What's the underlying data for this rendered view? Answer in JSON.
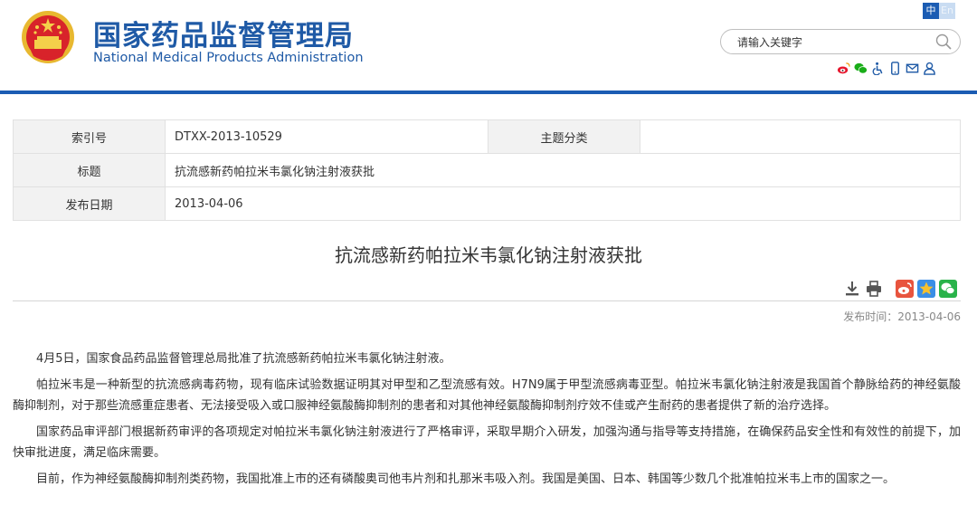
{
  "header": {
    "site_name_cn": "国家药品监督管理局",
    "site_name_en": "National Medical Products Administration",
    "lang_zh": "中",
    "lang_en": "En",
    "search_placeholder": "请输入关键字",
    "tool_icons": [
      "weibo-icon",
      "wechat-icon",
      "accessibility-icon",
      "mobile-icon",
      "mail-icon",
      "user-icon"
    ]
  },
  "info": {
    "index_label": "索引号",
    "index_value": "DTXX-2013-10529",
    "topic_label": "主题分类",
    "topic_value": "",
    "title_label": "标题",
    "title_value": "抗流感新药帕拉米韦氯化钠注射液获批",
    "date_label": "发布日期",
    "date_value": "2013-04-06"
  },
  "article": {
    "title": "抗流感新药帕拉米韦氯化钠注射液获批",
    "publish_time": "发布时间：2013-04-06",
    "tool_icons": [
      "download-icon",
      "print-icon",
      "share-weibo-icon",
      "share-qzone-icon",
      "share-wechat-icon"
    ],
    "paragraphs": [
      "4月5日，国家食品药品监督管理总局批准了抗流感新药帕拉米韦氯化钠注射液。",
      "帕拉米韦是一种新型的抗流感病毒药物，现有临床试验数据证明其对甲型和乙型流感有效。H7N9属于甲型流感病毒亚型。帕拉米韦氯化钠注射液是我国首个静脉给药的神经氨酸酶抑制剂，对于那些流感重症患者、无法接受吸入或口服神经氨酸酶抑制剂的患者和对其他神经氨酸酶抑制剂疗效不佳或产生耐药的患者提供了新的治疗选择。",
      "国家药品审评部门根据新药审评的各项规定对帕拉米韦氯化钠注射液进行了严格审评，采取早期介入研发，加强沟通与指导等支持措施，在确保药品安全性和有效性的前提下，加快审批进度，满足临床需要。",
      "目前，作为神经氨酸酶抑制剂类药物，我国批准上市的还有磷酸奥司他韦片剂和扎那米韦吸入剂。我国是美国、日本、韩国等少数几个批准帕拉米韦上市的国家之一。"
    ]
  },
  "colors": {
    "brand_blue": "#1f5aa6",
    "header_rule": "#1b5cb3",
    "label_bg": "#f2f2f2",
    "weibo_red": "#e6162d",
    "wechat_green": "#1aad19"
  }
}
